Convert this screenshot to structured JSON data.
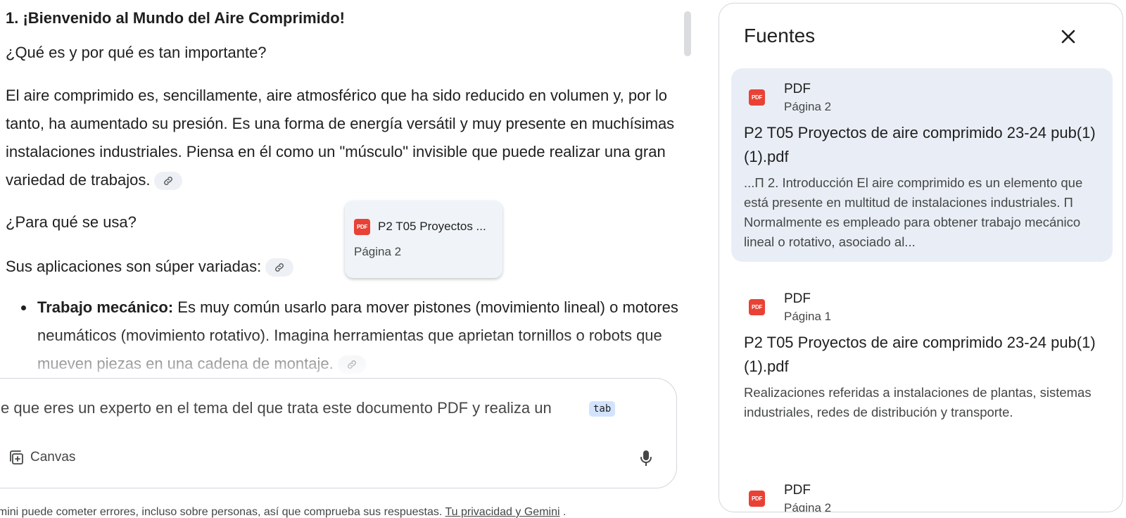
{
  "chat": {
    "heading": "1. ¡Bienvenido al Mundo del Aire Comprimido!",
    "subheading_what": "¿Qué es y por qué es tan importante?",
    "paragraph_intro": "El aire comprimido es, sencillamente, aire atmosférico que ha sido reducido en volumen y, por lo tanto, ha aumentado su presión. Es una forma de energía versátil y muy presente en muchísimas instalaciones industriales. Piensa en él como un \"músculo\" invisible que puede realizar una gran variedad de trabajos.",
    "subheading_uses": "¿Para qué se usa?",
    "paragraph_uses": "Sus aplicaciones son súper variadas:",
    "bullets": [
      {
        "label": "Trabajo mecánico:",
        "text": " Es muy común usarlo para mover pistones (movimiento lineal) o motores neumáticos (movimiento rotativo). Imagina herramientas que aprietan tornillos o robots que mueven piezas en una cadena de montaje."
      }
    ],
    "citation_icon": "link-icon"
  },
  "tooltip": {
    "badge": "PDF",
    "title": "P2 T05 Proyectos ...",
    "page": "Página 2"
  },
  "input": {
    "text": "e que eres un experto en el tema del que trata este documento PDF y realiza un",
    "tab_hint": "tab",
    "canvas_label": "Canvas",
    "canvas_icon": "canvas-add-icon",
    "mic_icon": "microphone-icon"
  },
  "disclaimer": {
    "text": "emini puede cometer errores, incluso sobre personas, así que comprueba sus respuestas. ",
    "link": "Tu privacidad y Gemini",
    "end": " ."
  },
  "sources": {
    "title": "Fuentes",
    "close_icon": "close-icon",
    "items": [
      {
        "badge": "PDF",
        "type": "PDF",
        "page": "Página 2",
        "title": "P2 T05 Proyectos de aire comprimido 23-24 pub(1) (1).pdf",
        "snippet": "...Π 2. Introducción El aire comprimido es un elemento que está presente en multitud de instalaciones industriales. Π Normalmente es empleado para obtener trabajo mecánico lineal o rotativo, asociado al..."
      },
      {
        "badge": "PDF",
        "type": "PDF",
        "page": "Página 1",
        "title": "P2 T05 Proyectos de aire comprimido 23-24 pub(1) (1).pdf",
        "snippet": "Realizaciones referidas a instalaciones de plantas, sistemas industriales, redes de distribución y transporte."
      },
      {
        "badge": "PDF",
        "type": "PDF",
        "page": "Página 2"
      }
    ]
  },
  "colors": {
    "pdf_red": "#e94235",
    "active_card": "#e9eef6",
    "tab_hint_bg": "#d3e3fd"
  }
}
